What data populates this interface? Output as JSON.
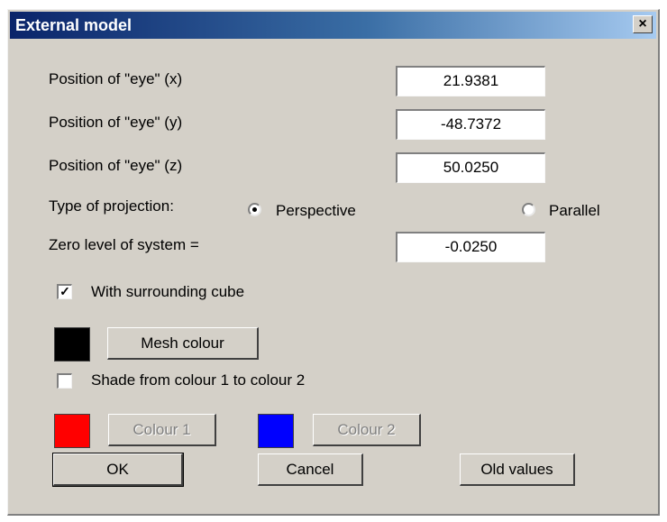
{
  "window": {
    "title": "External model",
    "close_label": "×"
  },
  "fields": {
    "eye_x": {
      "label": "Position of \"eye\" (x)",
      "value": "21.9381"
    },
    "eye_y": {
      "label": "Position of \"eye\" (y)",
      "value": "-48.7372"
    },
    "eye_z": {
      "label": "Position of \"eye\" (z)",
      "value": "50.0250"
    },
    "zero_level": {
      "label": "Zero level of system =",
      "value": "-0.0250"
    }
  },
  "projection": {
    "label": "Type of projection:",
    "options": [
      {
        "label": "Perspective",
        "selected": true
      },
      {
        "label": "Parallel",
        "selected": false
      }
    ]
  },
  "surrounding_cube": {
    "label": "With surrounding cube",
    "checked": true
  },
  "mesh": {
    "button_label": "Mesh colour",
    "color": "#000000"
  },
  "shade": {
    "label": "Shade from colour 1 to colour 2",
    "checked": false
  },
  "colour1": {
    "button_label": "Colour 1",
    "color": "#ff0000"
  },
  "colour2": {
    "button_label": "Colour 2",
    "color": "#0000ff"
  },
  "buttons": {
    "ok": "OK",
    "cancel": "Cancel",
    "old_values": "Old values"
  }
}
